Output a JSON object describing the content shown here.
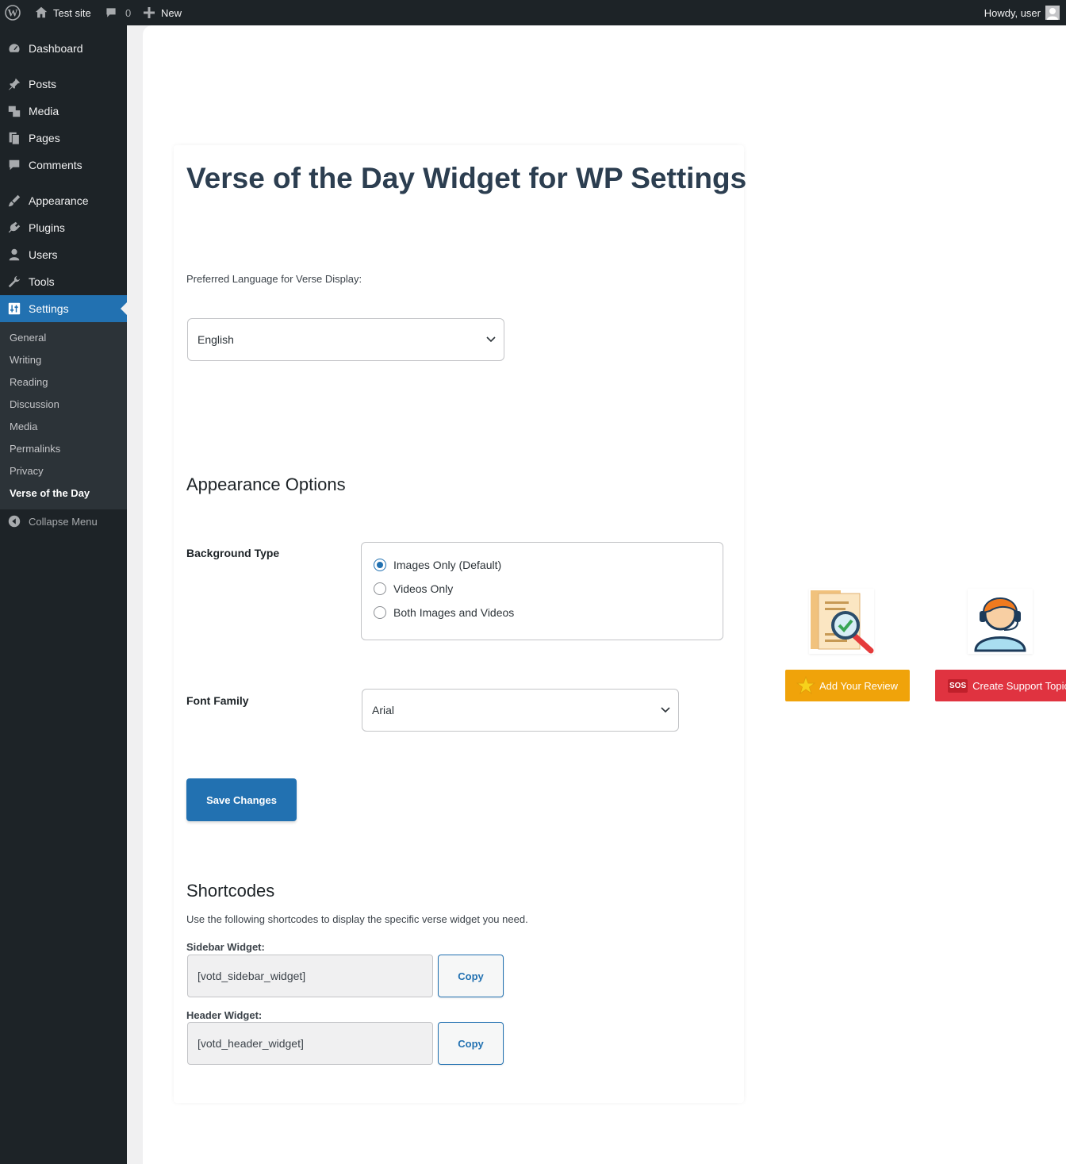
{
  "adminbar": {
    "site_name": "Test site",
    "comments_count": "0",
    "new_label": "New",
    "howdy": "Howdy, user"
  },
  "sidebar": {
    "items": [
      {
        "label": "Dashboard",
        "icon": "dashboard-icon"
      },
      {
        "label": "Posts",
        "icon": "pin-icon"
      },
      {
        "label": "Media",
        "icon": "media-icon"
      },
      {
        "label": "Pages",
        "icon": "pages-icon"
      },
      {
        "label": "Comments",
        "icon": "comment-icon"
      },
      {
        "label": "Appearance",
        "icon": "brush-icon"
      },
      {
        "label": "Plugins",
        "icon": "plug-icon"
      },
      {
        "label": "Users",
        "icon": "user-icon"
      },
      {
        "label": "Tools",
        "icon": "wrench-icon"
      },
      {
        "label": "Settings",
        "icon": "settings-icon",
        "current": true
      }
    ],
    "submenu": [
      "General",
      "Writing",
      "Reading",
      "Discussion",
      "Media",
      "Permalinks",
      "Privacy",
      "Verse of the Day"
    ],
    "collapse_label": "Collapse Menu"
  },
  "main": {
    "title": "Verse of the Day Widget for WP Settings",
    "language_label": "Preferred Language for Verse Display:",
    "language_value": "English",
    "appearance_heading": "Appearance Options",
    "background_label": "Background Type",
    "background_options": [
      {
        "label": "Images Only (Default)",
        "checked": true
      },
      {
        "label": "Videos Only",
        "checked": false
      },
      {
        "label": "Both Images and Videos",
        "checked": false
      }
    ],
    "font_label": "Font Family",
    "font_value": "Arial",
    "save_label": "Save Changes",
    "shortcodes_heading": "Shortcodes",
    "shortcodes_desc": "Use the following shortcodes to display the specific verse widget you need.",
    "sidebar_widget_label": "Sidebar Widget:",
    "sidebar_widget_code": "[votd_sidebar_widget]",
    "header_widget_label": "Header Widget:",
    "header_widget_code": "[votd_header_widget]",
    "copy_label": "Copy"
  },
  "promo": {
    "review_label": "Add Your Review",
    "support_label": "Create Support Topic",
    "sos_text": "SOS",
    "review_color": "#f0a30a",
    "support_color": "#e03340"
  },
  "colors": {
    "accent": "#2271b1",
    "sidebar_bg": "#1d2327"
  }
}
